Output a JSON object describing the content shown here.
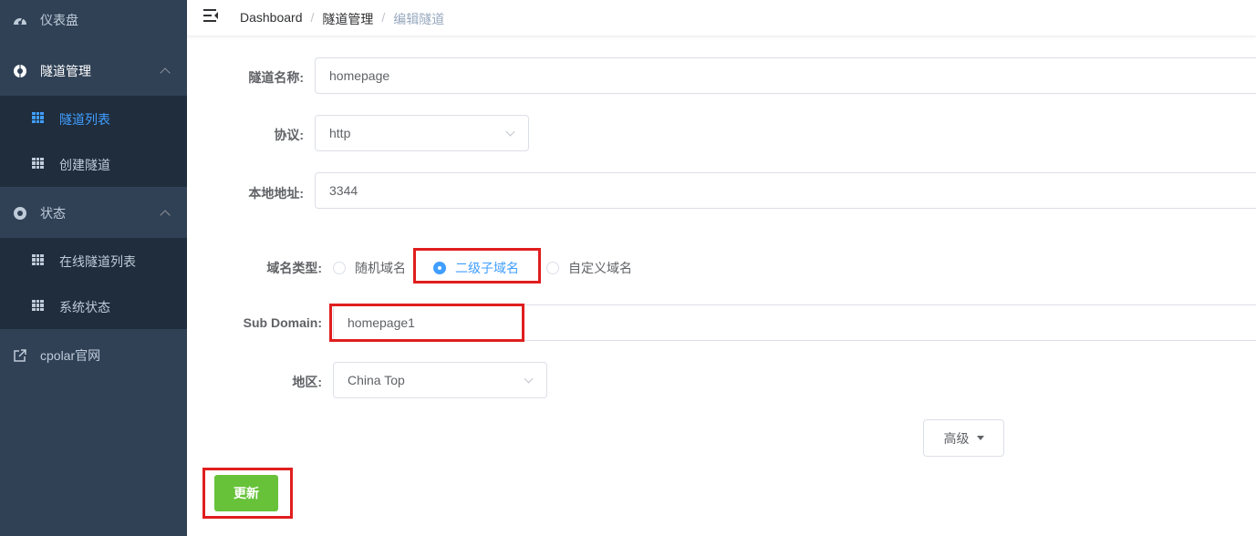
{
  "sidebar": {
    "dashboard": {
      "label": "仪表盘",
      "icon": "dashboard-icon"
    },
    "tunnel_mgmt": {
      "label": "隧道管理",
      "icon": "tunnel-icon",
      "expanded": true
    },
    "tunnel_list": {
      "label": "隧道列表",
      "icon": "grid-icon",
      "active": true
    },
    "create_tunnel": {
      "label": "创建隧道",
      "icon": "grid-icon"
    },
    "status": {
      "label": "状态",
      "icon": "status-icon",
      "expanded": true
    },
    "online_tunnels": {
      "label": "在线隧道列表",
      "icon": "grid-icon"
    },
    "system_status": {
      "label": "系统状态",
      "icon": "grid-icon"
    },
    "cpolar_site": {
      "label": "cpolar官网",
      "icon": "external-link-icon"
    }
  },
  "header": {
    "breadcrumb": [
      "Dashboard",
      "隧道管理",
      "编辑隧道"
    ],
    "separator": "/"
  },
  "form": {
    "name": {
      "label": "隧道名称:",
      "value": "homepage"
    },
    "protocol": {
      "label": "协议:",
      "value": "http"
    },
    "local_addr": {
      "label": "本地地址:",
      "value": "3344"
    },
    "domain_type": {
      "label": "域名类型:",
      "options": [
        "随机域名",
        "二级子域名",
        "自定义域名"
      ],
      "selected": "二级子域名"
    },
    "sub_domain": {
      "label": "Sub Domain:",
      "value": "homepage1"
    },
    "region": {
      "label": "地区:",
      "value": "China Top"
    },
    "advanced_label": "高级",
    "update_label": "更新"
  },
  "colors": {
    "sidebar_bg": "#304156",
    "submenu_bg": "#1f2d3d",
    "accent": "#409eff",
    "success": "#67c23a",
    "highlight": "#e01e1e"
  }
}
